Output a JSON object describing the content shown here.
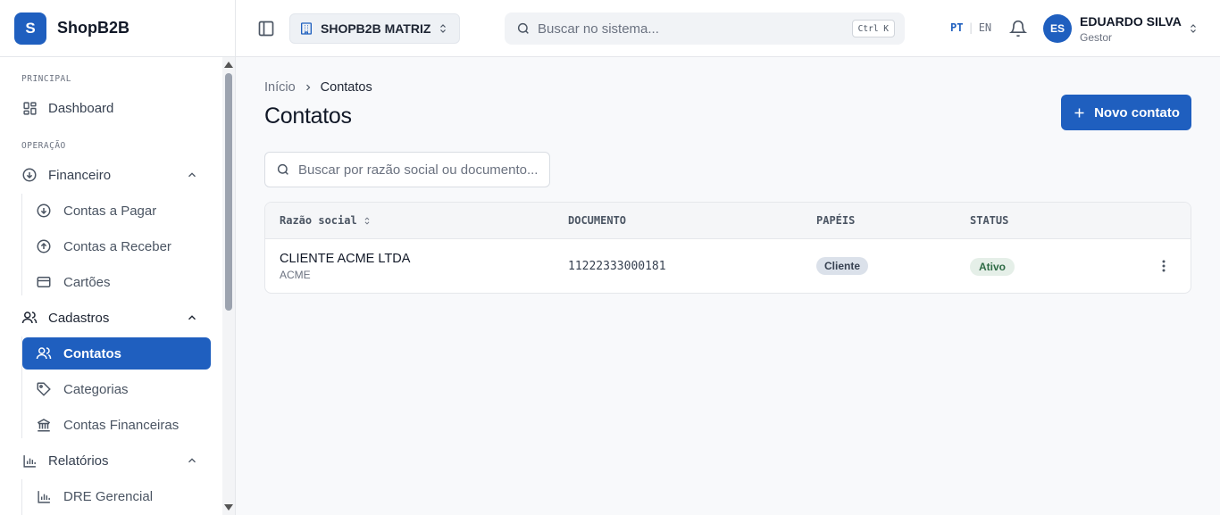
{
  "app": {
    "logo_letter": "S",
    "name": "ShopB2B"
  },
  "sidebar": {
    "sections": {
      "principal": "PRINCIPAL",
      "operacao": "OPERAÇÃO"
    },
    "items": {
      "dashboard": "Dashboard",
      "financeiro": "Financeiro",
      "contas_pagar": "Contas a Pagar",
      "contas_receber": "Contas a Receber",
      "cartoes": "Cartões",
      "cadastros": "Cadastros",
      "contatos": "Contatos",
      "categorias": "Categorias",
      "contas_financeiras": "Contas Financeiras",
      "relatorios": "Relatórios",
      "dre_gerencial": "DRE Gerencial"
    },
    "active_item": "contatos"
  },
  "header": {
    "org": "SHOPB2B MATRIZ",
    "search_placeholder": "Buscar no sistema...",
    "shortcut": "Ctrl K",
    "lang_active": "PT",
    "lang_other": "EN",
    "user_initials": "ES",
    "user_name": "EDUARDO SILVA",
    "user_role": "Gestor"
  },
  "main": {
    "breadcrumb": {
      "home": "Início",
      "current": "Contatos"
    },
    "title": "Contatos",
    "new_button": "Novo contato",
    "filter_placeholder": "Buscar por razão social ou documento...",
    "table": {
      "columns": {
        "razao_social": "Razão social",
        "documento": "DOCUMENTO",
        "papeis": "PAPÉIS",
        "status": "STATUS"
      },
      "rows": [
        {
          "name": "CLIENTE ACME LTDA",
          "fantasy": "ACME",
          "document": "11222333000181",
          "role": "Cliente",
          "status": "Ativo"
        }
      ]
    }
  },
  "colors": {
    "primary": "#1f5fbf",
    "status_active_bg": "#e5efe8",
    "status_active_text": "#2e6b45"
  }
}
